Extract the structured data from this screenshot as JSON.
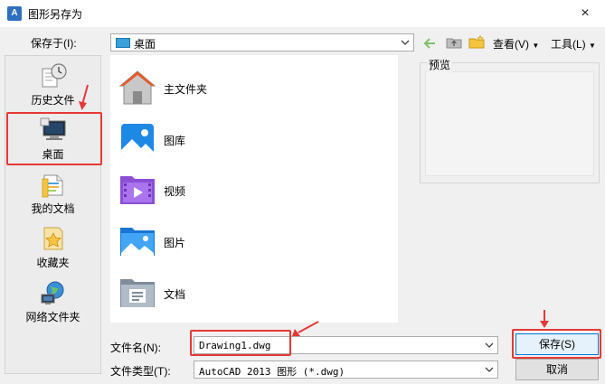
{
  "window": {
    "title": "图形另存为",
    "close_glyph": "×",
    "app_icon_glyph": "A"
  },
  "save_in": {
    "label": "保存于(I):",
    "value": "桌面"
  },
  "toolbar": {
    "view_label": "查看(V)",
    "tools_label": "工具(L)"
  },
  "places": [
    {
      "label": "历史文件"
    },
    {
      "label": "桌面"
    },
    {
      "label": "我的文档"
    },
    {
      "label": "收藏夹"
    },
    {
      "label": "网络文件夹"
    }
  ],
  "files": [
    {
      "name": "主文件夹"
    },
    {
      "name": "图库"
    },
    {
      "name": "视频"
    },
    {
      "name": "图片"
    },
    {
      "name": "文档"
    }
  ],
  "preview": {
    "label": "预览"
  },
  "file_name": {
    "label": "文件名(N):",
    "value": "Drawing1.dwg"
  },
  "file_type": {
    "label": "文件类型(T):",
    "value": "AutoCAD 2013 图形 (*.dwg)"
  },
  "buttons": {
    "save": "保存(S)",
    "cancel": "取消"
  },
  "colors": {
    "highlight": "#e53935",
    "accent": "#0078d7"
  }
}
